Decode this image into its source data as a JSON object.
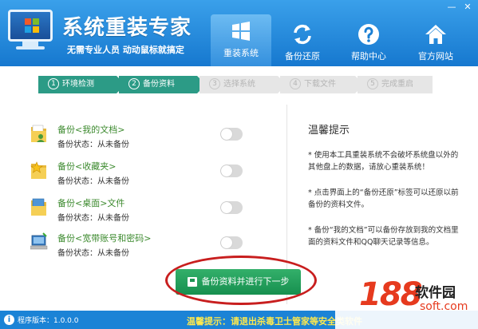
{
  "app": {
    "title": "系统重装专家",
    "slogan": "无需专业人员 动动鼠标就搞定"
  },
  "window_controls": {
    "minimize": "—",
    "close": "✕"
  },
  "nav": [
    {
      "label": "重装系统",
      "icon": "windows-logo-icon",
      "active": true
    },
    {
      "label": "备份还原",
      "icon": "refresh-icon",
      "active": false
    },
    {
      "label": "帮助中心",
      "icon": "question-icon",
      "active": false
    },
    {
      "label": "官方网站",
      "icon": "home-icon",
      "active": false
    }
  ],
  "steps": [
    {
      "num": "1",
      "label": "环境检测",
      "state": "done"
    },
    {
      "num": "2",
      "label": "备份资料",
      "state": "done"
    },
    {
      "num": "3",
      "label": "选择系统",
      "state": "todo"
    },
    {
      "num": "4",
      "label": "下载文件",
      "state": "todo"
    },
    {
      "num": "5",
      "label": "完成重启",
      "state": "todo"
    }
  ],
  "backup_items": [
    {
      "title": "备份<我的文档>",
      "status": "备份状态：从未备份",
      "icon": "documents-folder-icon",
      "enabled": false
    },
    {
      "title": "备份<收藏夹>",
      "status": "备份状态：从未备份",
      "icon": "favorites-folder-icon",
      "enabled": false
    },
    {
      "title": "备份<桌面>文件",
      "status": "备份状态：从未备份",
      "icon": "desktop-folder-icon",
      "enabled": false
    },
    {
      "title": "备份<宽带账号和密码>",
      "status": "备份状态：从未备份",
      "icon": "network-computer-icon",
      "enabled": false
    }
  ],
  "tips": {
    "title": "温馨提示",
    "items": [
      "* 使用本工具重装系统不会破坏系统盘以外的其他盘上的数据，请放心重装系统！",
      "* 点击界面上的“备份还原”标签可以还原以前备份的资料文件。",
      "* 备份“我的文档”可以备份存放到我的文档里面的资料文件和QQ聊天记录等信息。"
    ]
  },
  "main_button": {
    "label": "备份资料并进行下一步"
  },
  "footer": {
    "version": "程序版本：1.0.0.0",
    "warning": "温馨提示：请退出杀毒卫士管家等安全类软件"
  },
  "watermark": {
    "number": "188",
    "name": "软件园",
    "url": "soft.com"
  },
  "colors": {
    "header": "#1b83d6",
    "step_done": "#2c9b86",
    "button": "#17904f",
    "ring": "#c81e1e"
  }
}
